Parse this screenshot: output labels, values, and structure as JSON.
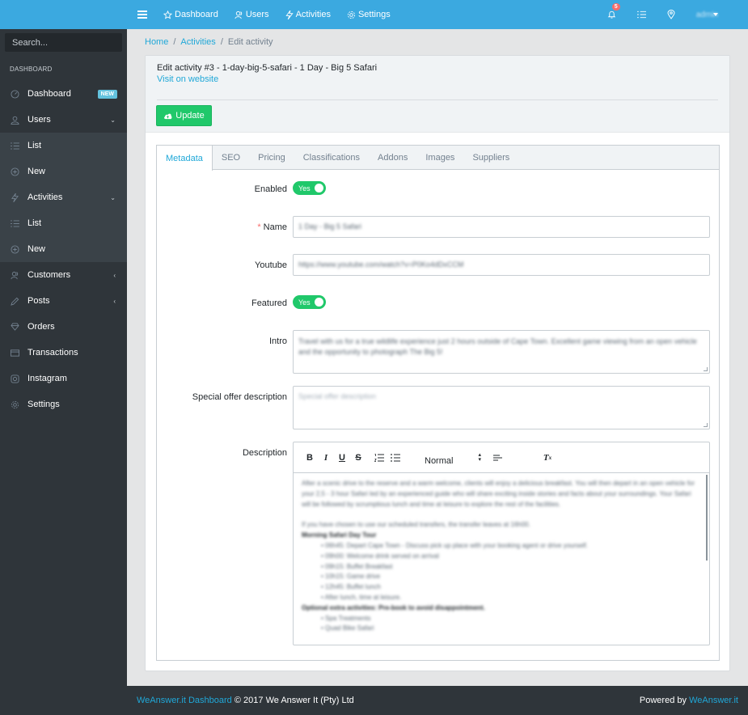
{
  "header": {
    "nav": [
      {
        "label": "Dashboard",
        "icon": "star-icon"
      },
      {
        "label": "Users",
        "icon": "users-icon"
      },
      {
        "label": "Activities",
        "icon": "bolt-icon"
      },
      {
        "label": "Settings",
        "icon": "gear-icon"
      }
    ],
    "notification_count": "5",
    "user_label": "admin"
  },
  "sidebar": {
    "search_placeholder": "Search...",
    "section_title": "DASHBOARD",
    "items": [
      {
        "label": "Dashboard",
        "icon": "speedometer-icon",
        "badge": "NEW"
      },
      {
        "label": "Users",
        "icon": "user-icon"
      },
      {
        "label": "List",
        "icon": "list-icon"
      },
      {
        "label": "New",
        "icon": "plus-circle-icon"
      },
      {
        "label": "Activities",
        "icon": "bolt-icon"
      },
      {
        "label": "List",
        "icon": "list-icon"
      },
      {
        "label": "New",
        "icon": "plus-circle-icon"
      },
      {
        "label": "Customers",
        "icon": "people-icon"
      },
      {
        "label": "Posts",
        "icon": "pencil-icon"
      },
      {
        "label": "Orders",
        "icon": "diamond-icon"
      },
      {
        "label": "Transactions",
        "icon": "card-icon"
      },
      {
        "label": "Instagram",
        "icon": "instagram-icon"
      },
      {
        "label": "Settings",
        "icon": "gear-icon"
      }
    ]
  },
  "breadcrumb": {
    "home": "Home",
    "activities": "Activities",
    "current": "Edit activity"
  },
  "card": {
    "title": "Edit activity #3 - 1-day-big-5-safari - 1 Day - Big 5 Safari",
    "visit_link": "Visit on website",
    "update_label": "Update"
  },
  "tabs": [
    "Metadata",
    "SEO",
    "Pricing",
    "Classifications",
    "Addons",
    "Images",
    "Suppliers"
  ],
  "form": {
    "enabled_label": "Enabled",
    "enabled_value": "Yes",
    "name_label": "Name",
    "name_required": "*",
    "name_value": "1 Day - Big 5 Safari",
    "youtube_label": "Youtube",
    "youtube_value": "https://www.youtube.com/watch?v=P0Ko4dDxCCM",
    "featured_label": "Featured",
    "featured_value": "Yes",
    "intro_label": "Intro",
    "intro_value": "Travel with us for a true wildlife experience just 2 hours outside of Cape Town. Excellent game viewing from an open vehicle and the opportunity to photograph The Big 5!",
    "special_label": "Special offer description",
    "special_placeholder": "Special offer description",
    "description_label": "Description",
    "editor_format": "Normal",
    "description": {
      "p1": "After a scenic drive to the reserve and a warm welcome, clients will enjoy a delicious breakfast. You will then depart in an open vehicle for your 2,5 - 3 hour Safari led by an experienced guide who will share exciting inside stories and facts about your surroundings. Your Safari will be followed by scrumptious lunch and time at leisure to explore the rest of the facilities.",
      "p2": "If you have chosen to use our scheduled transfers, the transfer leaves at 16h00.",
      "heading1": "Morning Safari Day Tour",
      "items1": [
        "06h45: Depart Cape Town - Discuss pick up place with your booking agent or drive yourself.",
        "09h00: Welcome drink served on arrival",
        "09h15: Buffet Breakfast",
        "10h15: Game drive",
        "12h45: Buffet lunch",
        "After lunch, time at leisure."
      ],
      "heading2": "Optional extra activities: Pre-book to avoid disappointment.",
      "items2": [
        "Spa Treatments",
        "Quad Bike Safari"
      ]
    }
  },
  "footer": {
    "brand_link": "WeAnswer.it Dashboard",
    "copyright": "© 2017 We Answer It (Pty) Ltd",
    "powered_by": "Powered by",
    "powered_link": "WeAnswer.it"
  }
}
